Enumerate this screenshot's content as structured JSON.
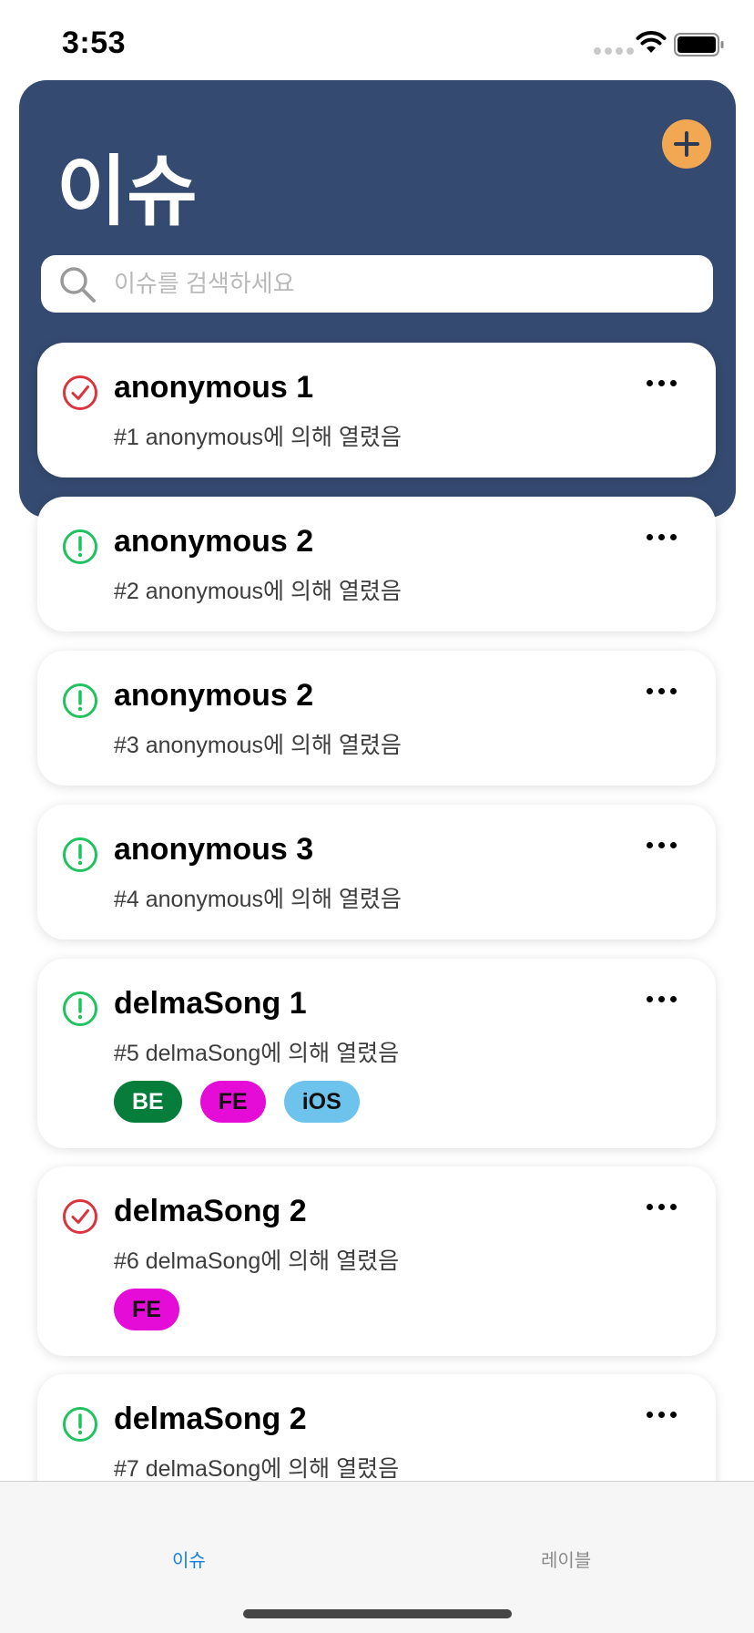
{
  "status_bar": {
    "time": "3:53"
  },
  "header": {
    "title": "이슈",
    "add_icon": "plus-icon",
    "search": {
      "placeholder": "이슈를 검색하세요",
      "value": ""
    }
  },
  "colors": {
    "header_bg": "#354a70",
    "add_button": "#f2a852",
    "open_status": "#1fc25f",
    "closed_status": "#d9343f",
    "tab_active": "#1b7fe0",
    "tab_inactive": "#8a8a8a"
  },
  "issues": [
    {
      "title": "anonymous 1",
      "subtitle": "#1 anonymous에 의해 열렸음",
      "status": "closed",
      "labels": []
    },
    {
      "title": "anonymous 2",
      "subtitle": "#2 anonymous에 의해 열렸음",
      "status": "open",
      "labels": []
    },
    {
      "title": "anonymous 2",
      "subtitle": "#3 anonymous에 의해 열렸음",
      "status": "open",
      "labels": []
    },
    {
      "title": "anonymous 3",
      "subtitle": "#4 anonymous에 의해 열렸음",
      "status": "open",
      "labels": []
    },
    {
      "title": "delmaSong 1",
      "subtitle": "#5 delmaSong에 의해 열렸음",
      "status": "open",
      "labels": [
        {
          "name": "BE",
          "bg": "#077d3b",
          "fg": "#ffffff"
        },
        {
          "name": "FE",
          "bg": "#e60cd8",
          "fg": "#111111"
        },
        {
          "name": "iOS",
          "bg": "#6ec3ec",
          "fg": "#111111"
        }
      ]
    },
    {
      "title": "delmaSong 2",
      "subtitle": "#6 delmaSong에 의해 열렸음",
      "status": "closed",
      "labels": [
        {
          "name": "FE",
          "bg": "#e60cd8",
          "fg": "#111111"
        }
      ]
    },
    {
      "title": "delmaSong 2",
      "subtitle": "#7 delmaSong에 의해 열렸음",
      "status": "open",
      "labels": []
    }
  ],
  "tab_bar": {
    "tabs": [
      {
        "label": "이슈",
        "active": true
      },
      {
        "label": "레이블",
        "active": false
      }
    ]
  }
}
